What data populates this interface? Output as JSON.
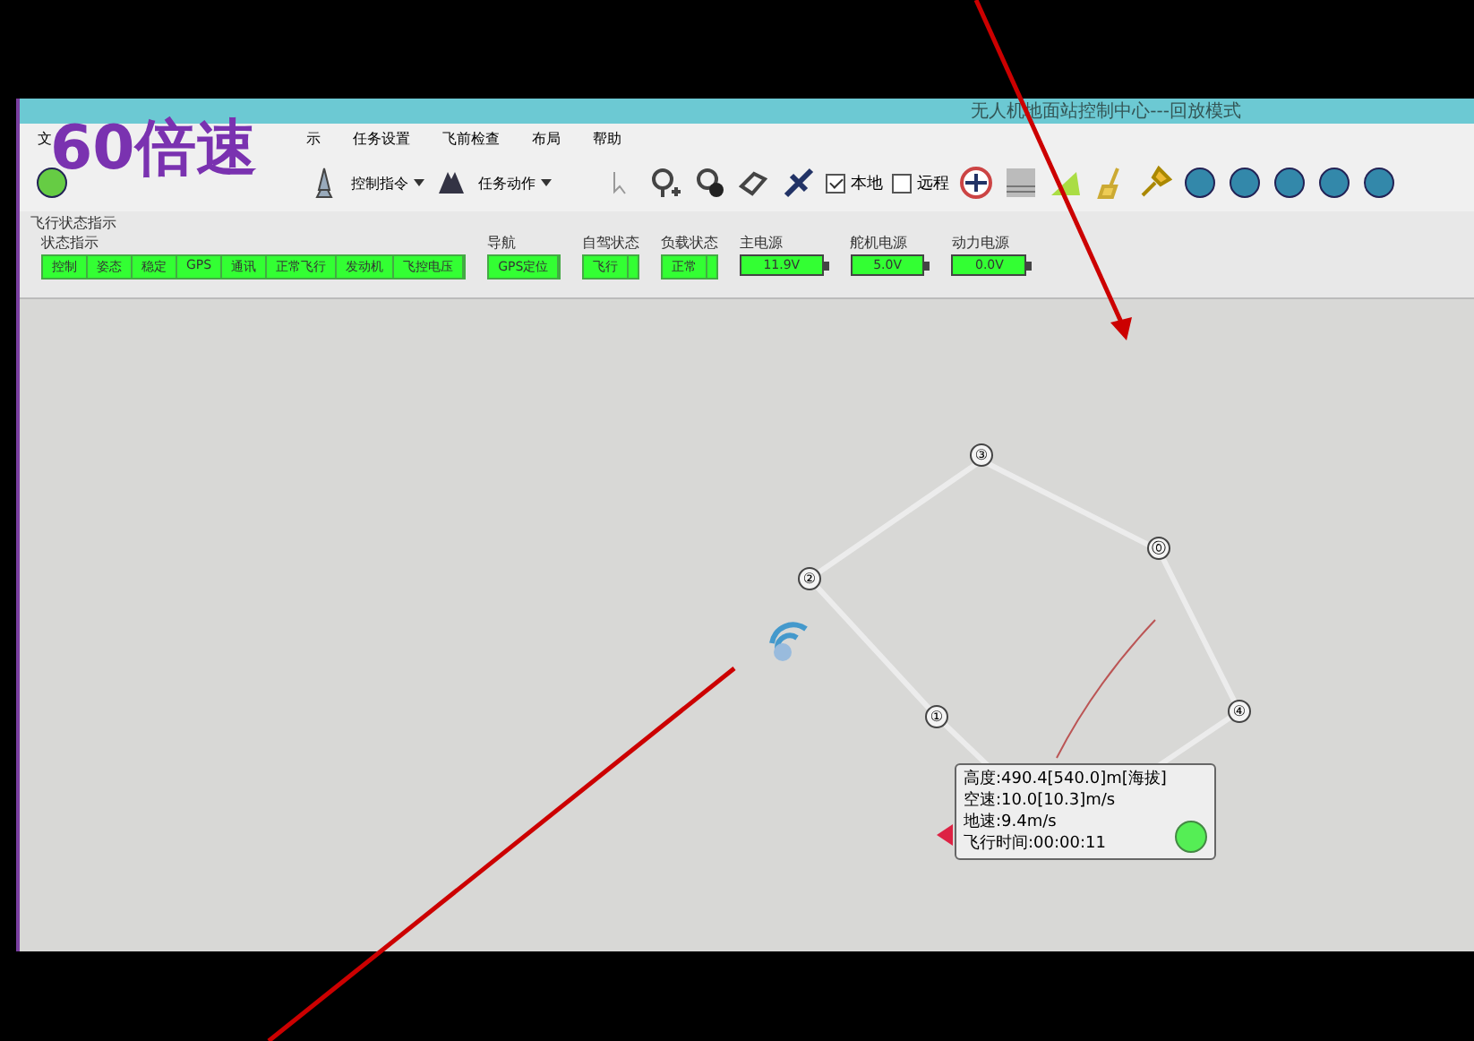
{
  "window": {
    "title": "无人机地面站控制中心---回放模式"
  },
  "overlay_caption": "60倍速",
  "menu": [
    "文",
    "示",
    "任务设置",
    "飞前检查",
    "布局",
    "帮助"
  ],
  "toolbar": {
    "dropdowns": [
      "控制指令",
      "任务动作"
    ],
    "checkboxes": [
      {
        "label": "本地",
        "checked": true
      },
      {
        "label": "远程",
        "checked": false
      }
    ]
  },
  "status_panel": {
    "title": "飞行状态指示",
    "groups": [
      {
        "label": "状态指示",
        "cells": [
          "控制",
          "姿态",
          "稳定",
          "GPS",
          "通讯",
          "正常飞行",
          "发动机",
          "飞控电压"
        ]
      },
      {
        "label": "导航",
        "cells": [
          "GPS定位"
        ]
      },
      {
        "label": "自驾状态",
        "cells": [
          "飞行"
        ]
      },
      {
        "label": "负载状态",
        "cells": [
          "正常"
        ]
      }
    ],
    "power": [
      {
        "label": "主电源",
        "reading": "11.9V"
      },
      {
        "label": "舵机电源",
        "reading": "5.0V"
      },
      {
        "label": "动力电源",
        "reading": "0.0V"
      }
    ]
  },
  "map": {
    "waypoints": [
      {
        "label": "③"
      },
      {
        "label": "⓪"
      },
      {
        "label": "②"
      },
      {
        "label": "①"
      },
      {
        "label": "④"
      }
    ],
    "info": [
      "高度:490.4[540.0]m[海拔]",
      "空速:10.0[10.3]m/s",
      "地速:9.4m/s",
      "飞行时间:00:00:11"
    ]
  }
}
